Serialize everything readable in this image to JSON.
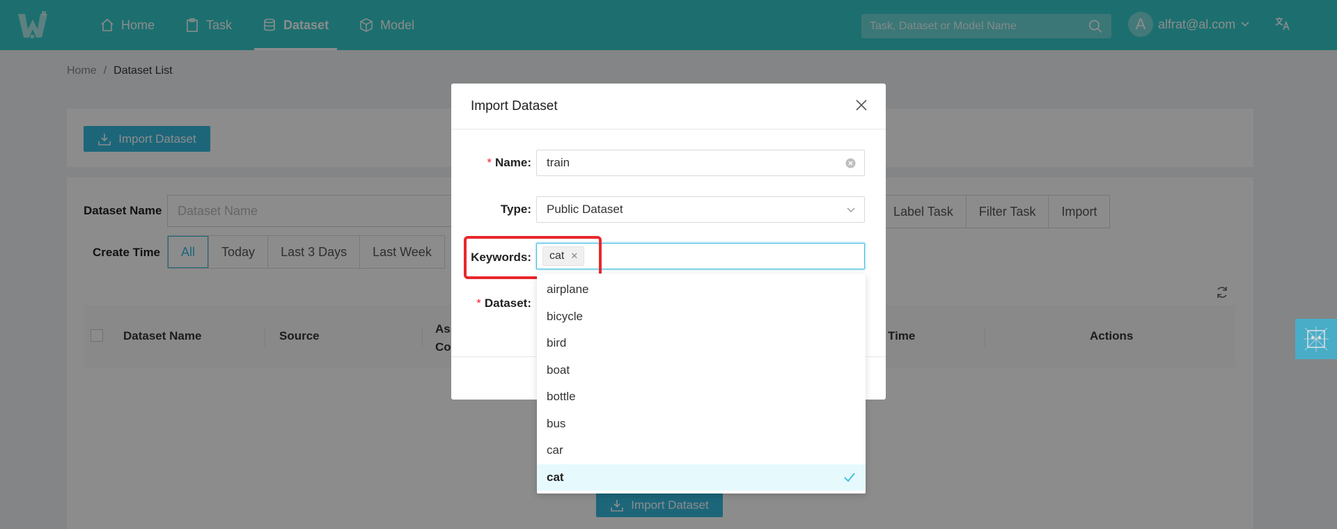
{
  "header": {
    "nav": [
      {
        "label": "Home",
        "icon": "home-icon"
      },
      {
        "label": "Task",
        "icon": "clipboard-icon"
      },
      {
        "label": "Dataset",
        "icon": "database-icon",
        "active": true
      },
      {
        "label": "Model",
        "icon": "cube-icon"
      }
    ],
    "search_placeholder": "Task, Dataset or Model Name",
    "user_initial": "A",
    "user_email": "alfrat@al.com"
  },
  "breadcrumb": {
    "root": "Home",
    "separator": "/",
    "current": "Dataset List"
  },
  "toolbar": {
    "import_label": "Import Dataset"
  },
  "filters": {
    "name_label": "Dataset Name",
    "name_placeholder": "Dataset Name",
    "time_label": "Create Time",
    "time_options": [
      "All",
      "Today",
      "Last 3 Days",
      "Last Week"
    ],
    "action_tabs": [
      "Label Task",
      "Filter Task",
      "Import"
    ]
  },
  "table": {
    "columns": [
      "Dataset Name",
      "Source",
      "Ass Co",
      "Time",
      "Actions"
    ],
    "empty_import_label": "Import Dataset"
  },
  "modal": {
    "title": "Import Dataset",
    "name_label": "Name",
    "name_value": "train",
    "type_label": "Type",
    "type_value": "Public Dataset",
    "keywords_label": "Keywords",
    "keyword_tag": "cat",
    "dataset_label": "Dataset",
    "colon": ":"
  },
  "dropdown": {
    "options": [
      "airplane",
      "bicycle",
      "bird",
      "boat",
      "bottle",
      "bus",
      "car",
      "cat"
    ],
    "selected": "cat"
  },
  "colors": {
    "accent": "#36bbdf",
    "header": "#36cbcb",
    "highlight": "#e8282b"
  }
}
